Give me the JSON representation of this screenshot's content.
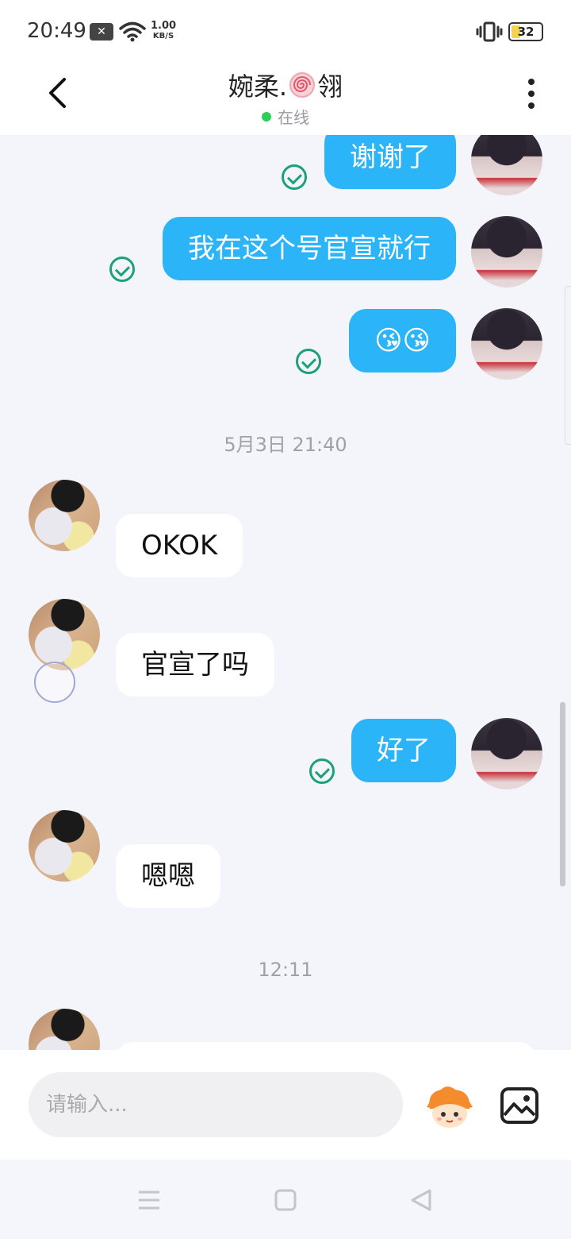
{
  "status_bar": {
    "time": "20:49",
    "speed_value": "1.00",
    "speed_unit": "KB/S",
    "battery": "32"
  },
  "header": {
    "title_prefix": "婉柔.",
    "title_suffix": "翎",
    "status": "在线"
  },
  "messages": [
    {
      "side": "out",
      "text": "谢谢了"
    },
    {
      "side": "out",
      "text": "我在这个号官宣就行"
    },
    {
      "side": "out",
      "text": "😘😘"
    },
    {
      "type": "timestamp",
      "text": "5月3日 21:40"
    },
    {
      "side": "in",
      "text": "OKOK"
    },
    {
      "side": "in",
      "text": "官宣了吗"
    },
    {
      "side": "out",
      "text": "好了"
    },
    {
      "side": "in",
      "text": "嗯嗯"
    },
    {
      "type": "timestamp",
      "text": "12:11"
    }
  ],
  "input": {
    "placeholder": "请输入..."
  },
  "icons": {
    "back": "back-arrow-icon",
    "more": "more-vertical-icon",
    "sticker": "mascot-sticker-icon",
    "image": "image-icon",
    "read": "read-check-icon"
  },
  "colors": {
    "outgoing_bubble": "#2bb4f8",
    "incoming_bubble": "#ffffff",
    "read_check": "#1aa176",
    "online": "#2ecc59",
    "background": "#f4f5fa"
  }
}
